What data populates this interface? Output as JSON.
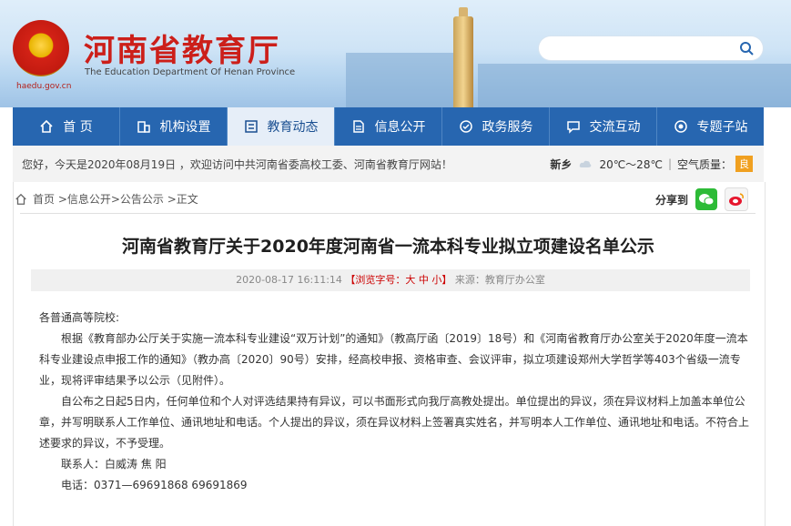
{
  "header": {
    "title": "河南省教育厅",
    "subtitle": "The Education Department Of Henan Province",
    "emblem_url": "haedu.gov.cn",
    "search": {
      "placeholder": ""
    }
  },
  "nav": {
    "items": [
      {
        "label": "首 页",
        "icon": "home-icon"
      },
      {
        "label": "机构设置",
        "icon": "building-icon"
      },
      {
        "label": "教育动态",
        "icon": "news-icon",
        "active": true
      },
      {
        "label": "信息公开",
        "icon": "document-icon"
      },
      {
        "label": "政务服务",
        "icon": "service-icon"
      },
      {
        "label": "交流互动",
        "icon": "chat-icon"
      },
      {
        "label": "专题子站",
        "icon": "target-icon"
      }
    ]
  },
  "welcome": {
    "text": "您好，今天是2020年08月19日 ，欢迎访问中共河南省委高校工委、河南省教育厅网站！",
    "city": "新乡",
    "temp": "20℃～28℃",
    "sep": "|",
    "aq_label": "空气质量：",
    "aq_value": "良"
  },
  "breadcrumb": "首页 >信息公开>公告公示 >正文",
  "share_label": "分享到",
  "article": {
    "title": "河南省教育厅关于2020年度河南省一流本科专业拟立项建设名单公示",
    "date": "2020-08-17 16:11:14",
    "font_size": "【浏览字号：大 中 小】",
    "source": "来源：教育厅办公室",
    "salutation": "各普通高等院校:",
    "p1": "根据《教育部办公厅关于实施一流本科专业建设“双万计划”的通知》（教高厅函〔2019〕18号）和《河南省教育厅办公室关于2020年度一流本科专业建设点申报工作的通知》（教办高〔2020〕90号）安排，经高校申报、资格审查、会议评审，拟立项建设郑州大学哲学等403个省级一流专业，现将评审结果予以公示（见附件）。",
    "p2": "自公布之日起5日内，任何单位和个人对评选结果持有异议，可以书面形式向我厅高教处提出。单位提出的异议，须在异议材料上加盖本单位公章，并写明联系人工作单位、通讯地址和电话。个人提出的异议，须在异议材料上签署真实姓名，并写明本人工作单位、通讯地址和电话。不符合上述要求的异议，不予受理。",
    "contact": "联系人：白威涛  焦 阳",
    "phone": "电话：0371—69691868 69691869"
  },
  "colors": {
    "nav_bg": "#2766b0",
    "title_red": "#cc1f1a",
    "active_tab_bg": "#e6eef8"
  }
}
